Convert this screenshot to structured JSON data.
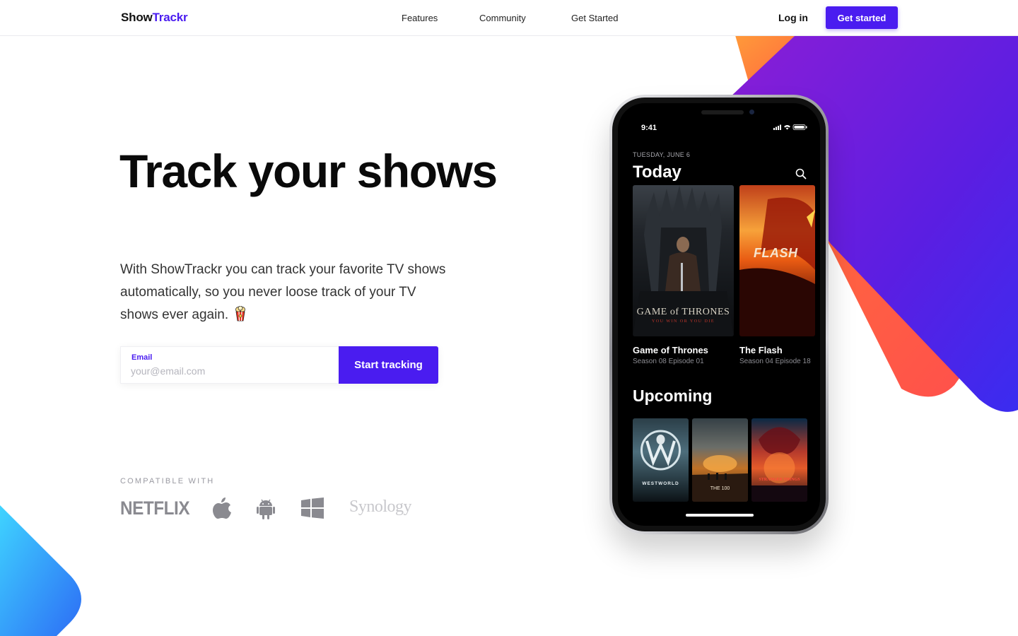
{
  "nav": {
    "brand_part1": "Show",
    "brand_part2": "Trackr",
    "links": [
      "Features",
      "Community",
      "Get Started"
    ],
    "login": "Log in",
    "cta": "Get started"
  },
  "hero": {
    "title": "Track your shows",
    "description": "With ShowTrackr you can track your favorite TV shows automatically, so you never loose track of your TV shows ever again.",
    "emoji_icon": "popcorn-icon"
  },
  "signup": {
    "label": "Email",
    "placeholder": "your@email.com",
    "button": "Start tracking"
  },
  "compatible": {
    "label": "COMPATIBLE WITH",
    "logos": [
      "netflix-logo",
      "apple-icon",
      "android-icon",
      "windows-icon",
      "synology-logo"
    ],
    "netflix_text": "NETFLIX",
    "synology_text": "Synology"
  },
  "phone": {
    "time": "9:41",
    "date": "TUESDAY, JUNE 6",
    "today_heading": "Today",
    "today_shows": [
      {
        "title": "Game of Thrones",
        "subtitle": "Season 08 Episode 01",
        "poster_title": "GAME of THRONES",
        "poster_tag": "YOU WIN OR YOU DIE"
      },
      {
        "title": "The Flash",
        "subtitle": "Season 04 Episode 18",
        "poster_title": "FLASH"
      }
    ],
    "upcoming_heading": "Upcoming",
    "upcoming_posters": [
      "WESTWORLD",
      "THE 100",
      "STRANGER THINGS"
    ]
  },
  "colors": {
    "accent": "#4a1cf0",
    "accent_purple": "#7b1fd8",
    "orange": "#ff8a3c",
    "red": "#ff5444",
    "blue": "#2f7cf6"
  }
}
